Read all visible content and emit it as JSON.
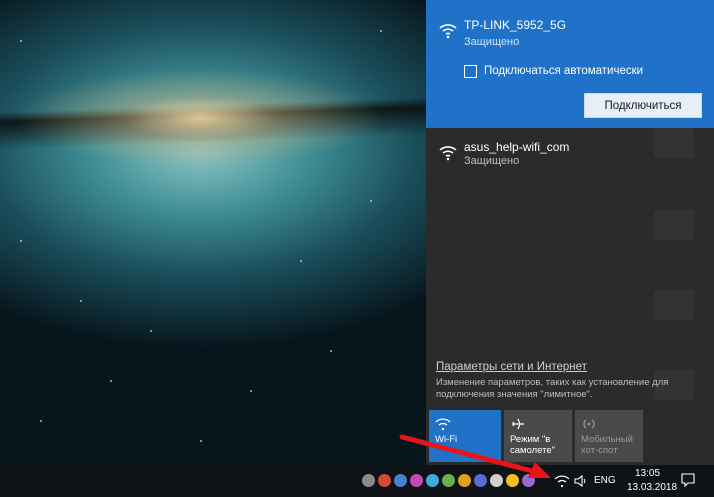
{
  "networks": [
    {
      "name": "TP-LINK_5952_5G",
      "status": "Защищено",
      "auto_connect_label": "Подключаться автоматически",
      "connect_button": "Подключиться"
    },
    {
      "name": "asus_help-wifi_com",
      "status": "Защищено"
    }
  ],
  "settings": {
    "link": "Параметры сети и Интернет",
    "description": "Изменение параметров, таких как установление для подключения значения \"лимитное\"."
  },
  "quick_actions": [
    {
      "label": "Wi-Fi",
      "icon": "wifi-icon"
    },
    {
      "label": "Режим \"в самолете\"",
      "icon": "airplane-icon"
    },
    {
      "label": "Мобильный хот-спот",
      "icon": "hotspot-icon"
    }
  ],
  "taskbar": {
    "language": "ENG",
    "time": "13:05",
    "date": "13.03.2018"
  },
  "colors": {
    "accent": "#1f72c8",
    "flyout_bg": "#2b2b2b",
    "arrow": "#e8141a"
  }
}
